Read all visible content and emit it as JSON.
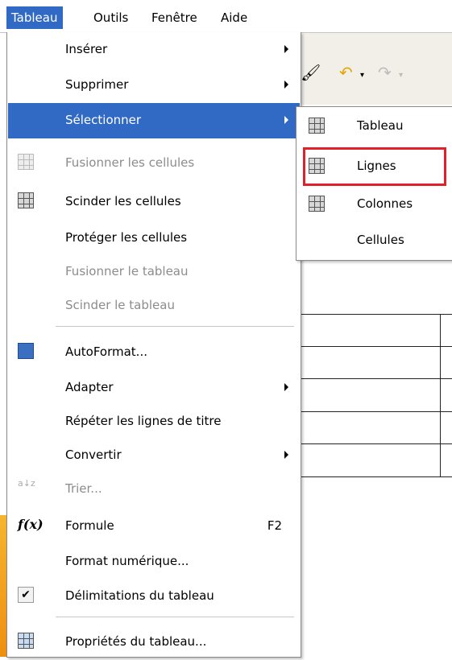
{
  "menubar": {
    "items": [
      "Tableau",
      "Outils",
      "Fenêtre",
      "Aide"
    ]
  },
  "menu": {
    "items": [
      {
        "label": "Insérer",
        "submenu": true
      },
      {
        "label": "Supprimer",
        "submenu": true
      },
      {
        "label": "Sélectionner",
        "submenu": true,
        "highlighted": true
      },
      {
        "label": "Fusionner les cellules",
        "disabled": true
      },
      {
        "label": "Scinder les cellules"
      },
      {
        "label": "Protéger les cellules"
      },
      {
        "label": "Fusionner le tableau",
        "disabled": true
      },
      {
        "label": "Scinder le tableau",
        "disabled": true
      },
      {
        "label": "AutoFormat..."
      },
      {
        "label": "Adapter",
        "submenu": true
      },
      {
        "label": "Répéter les lignes de titre"
      },
      {
        "label": "Convertir",
        "submenu": true
      },
      {
        "label": "Trier...",
        "disabled": true
      },
      {
        "label": "Formule",
        "shortcut": "F2"
      },
      {
        "label": "Format numérique..."
      },
      {
        "label": "Délimitations du tableau",
        "checked": true
      },
      {
        "label": "Propriétés du tableau..."
      }
    ]
  },
  "submenu": {
    "items": [
      {
        "label": "Tableau"
      },
      {
        "label": "Lignes"
      },
      {
        "label": "Colonnes"
      },
      {
        "label": "Cellules"
      }
    ]
  },
  "colors": {
    "highlight": "#316ac5",
    "callout": "#e0202a"
  }
}
